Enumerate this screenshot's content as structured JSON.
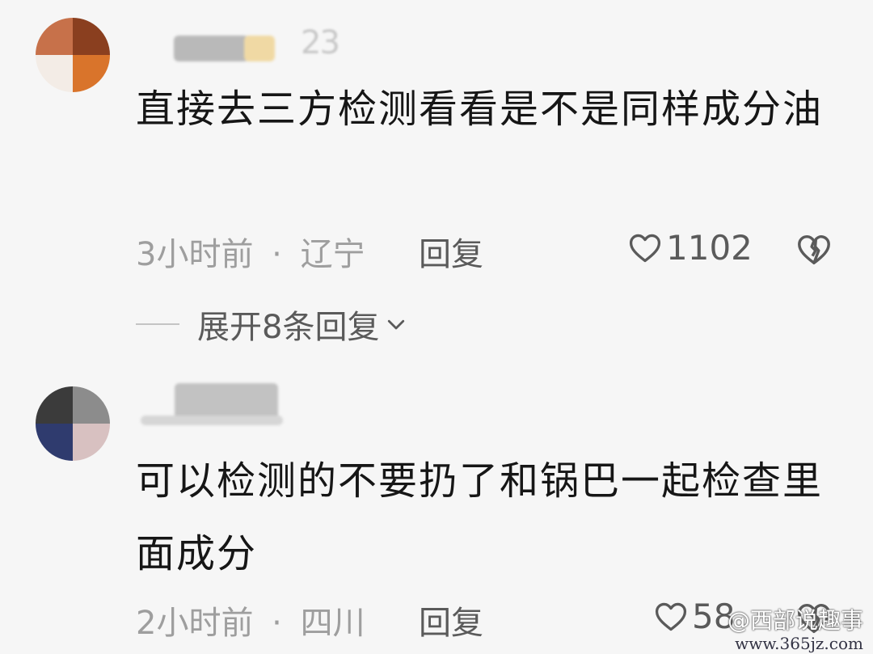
{
  "comments": [
    {
      "username_tail": "23",
      "body": "直接去三方检测看看是不是同样成分油",
      "time": "3小时前",
      "separator": "·",
      "location": "辽宁",
      "reply_label": "回复",
      "like_count": "1102",
      "expand_label": "展开8条回复"
    },
    {
      "body": "可以检测的不要扔了和锅巴一起检查里面成分",
      "time": "2小时前",
      "separator": "·",
      "location": "四川",
      "reply_label": "回复",
      "like_count": "58"
    }
  ],
  "watermark": {
    "text": "@西部说趣事",
    "url": "www.365jz.com"
  },
  "icons": {
    "like": "heart-outline-icon",
    "dislike": "broken-heart-icon",
    "expand": "chevron-down-icon"
  },
  "colors": {
    "background": "#f6f6f6",
    "body_text": "#161616",
    "meta_text": "#9e9e9e",
    "action_text": "#5a5a5a"
  }
}
